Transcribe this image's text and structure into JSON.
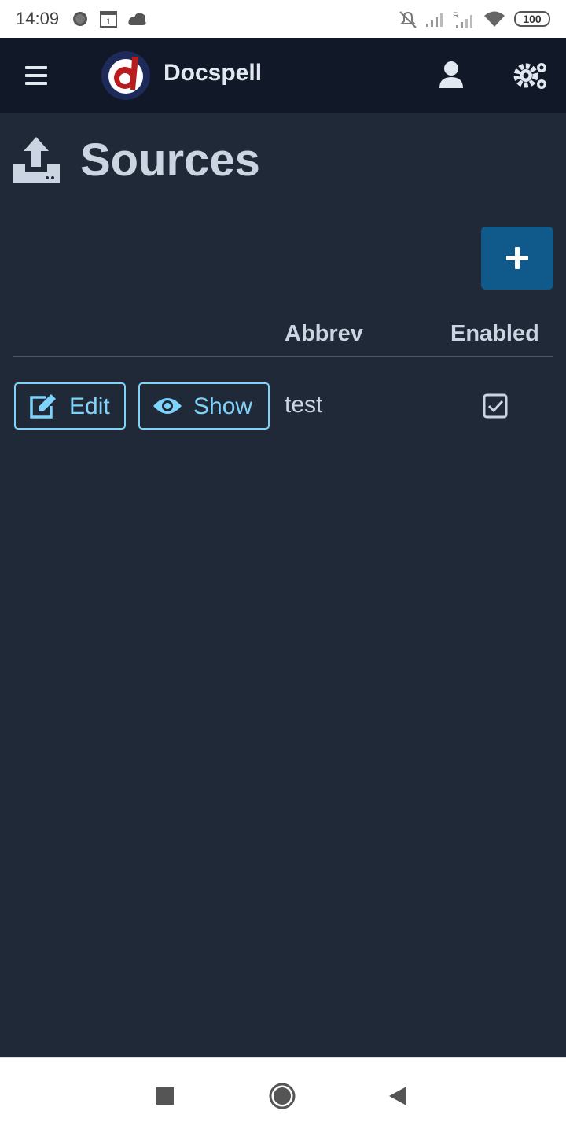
{
  "status_bar": {
    "time": "14:09",
    "battery": "100",
    "icons": [
      "chat-bubble-icon",
      "calendar-icon",
      "cloud-icon",
      "mute-icon",
      "signal-icon",
      "roaming-signal-icon",
      "wifi-icon",
      "battery-icon"
    ]
  },
  "nav": {
    "brand": "Docspell",
    "colors": {
      "bar": "#111827",
      "logo_red": "#b91c1c",
      "logo_ring": "#1e3a8a"
    }
  },
  "page": {
    "title": "Sources",
    "icon": "upload-inbox-icon"
  },
  "add_button": {
    "icon": "plus-icon",
    "color": "#0f5a8a"
  },
  "table": {
    "columns": [
      "",
      "Abbrev",
      "Enabled"
    ],
    "rows": [
      {
        "edit_label": "Edit",
        "show_label": "Show",
        "abbrev": "test",
        "enabled": true
      }
    ]
  },
  "accent": "#7dd3fc",
  "android_nav": [
    "recents-square-icon",
    "home-circle-icon",
    "back-triangle-icon"
  ]
}
